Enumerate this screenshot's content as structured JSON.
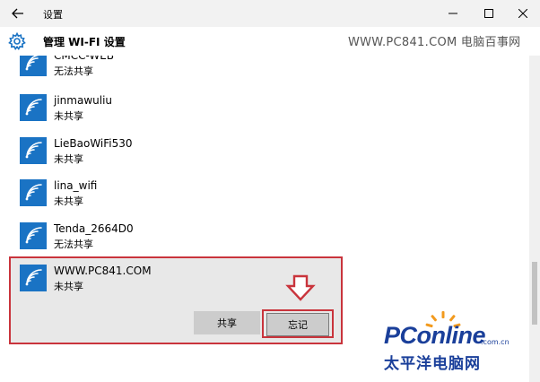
{
  "window": {
    "title": "设置"
  },
  "header": {
    "title": "管理 WI-FI 设置",
    "watermark": "WWW.PC841.COM 电脑百事网"
  },
  "networks": [
    {
      "name": "CMCC-WEB",
      "status": "无法共享"
    },
    {
      "name": "jinmawuliu",
      "status": "未共享"
    },
    {
      "name": "LieBaoWiFi530",
      "status": "未共享"
    },
    {
      "name": "lina_wifi",
      "status": "未共享"
    },
    {
      "name": "Tenda_2664D0",
      "status": "无法共享"
    },
    {
      "name": "WWW.PC841.COM",
      "status": "未共享"
    }
  ],
  "actions": {
    "share_label": "共享",
    "forget_label": "忘记"
  },
  "logo": {
    "brand": "PConline",
    "domain": ".com.cn",
    "chinese": "太平洋电脑网"
  },
  "colors": {
    "accent": "#1a73c4",
    "highlight": "#c9343c",
    "logo": "#1a3f9a"
  }
}
